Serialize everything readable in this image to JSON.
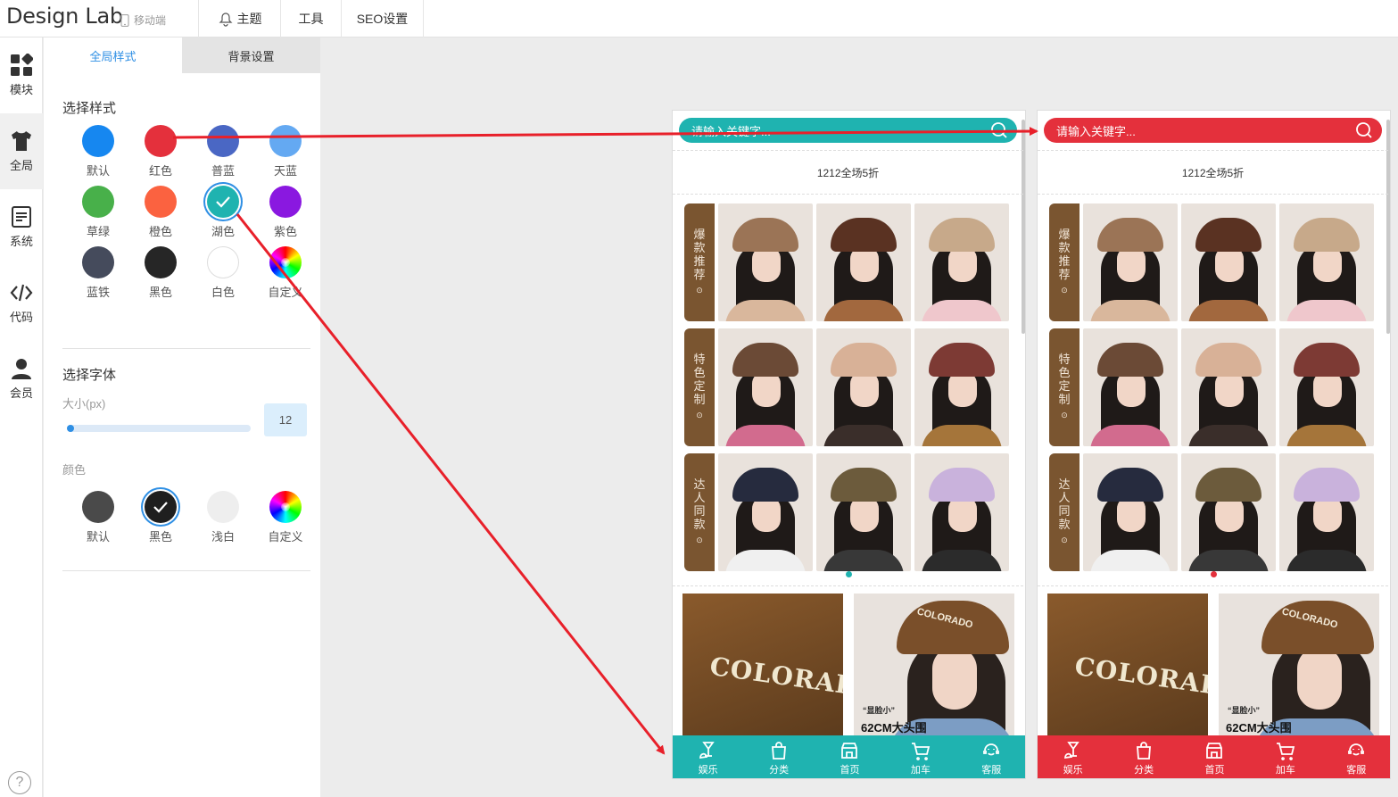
{
  "app": {
    "brand": "Design Lab",
    "mode": "移动端"
  },
  "topnav": {
    "theme": "主题",
    "tools": "工具",
    "seo": "SEO设置"
  },
  "rail": {
    "modules": "模块",
    "global": "全局",
    "system": "系统",
    "code": "代码",
    "member": "会员",
    "help": "?"
  },
  "panel": {
    "tab_global": "全局样式",
    "tab_background": "背景设置",
    "style_title": "选择样式",
    "styles": [
      {
        "label": "默认",
        "color": "#1687f0"
      },
      {
        "label": "红色",
        "color": "#e4303c"
      },
      {
        "label": "普蓝",
        "color": "#4a67c4"
      },
      {
        "label": "天蓝",
        "color": "#64a9f2"
      },
      {
        "label": "草绿",
        "color": "#48b04a"
      },
      {
        "label": "橙色",
        "color": "#fb6240"
      },
      {
        "label": "湖色",
        "color": "#1fb3b0",
        "selected": true
      },
      {
        "label": "紫色",
        "color": "#8a18e0"
      },
      {
        "label": "蓝铁",
        "color": "#454b5c"
      },
      {
        "label": "黑色",
        "color": "#262626"
      },
      {
        "label": "白色",
        "color": "#ffffff"
      },
      {
        "label": "自定义",
        "color": "rainbow"
      }
    ],
    "font_title": "选择字体",
    "size_label": "大小(px)",
    "size_value": "12",
    "color_label": "颜色",
    "font_colors": [
      {
        "label": "默认",
        "color": "#4a4a4a"
      },
      {
        "label": "黑色",
        "color": "#1f1f1f",
        "selected": true
      },
      {
        "label": "浅白",
        "color": "#eeeeee"
      },
      {
        "label": "自定义",
        "color": "rainbow"
      }
    ]
  },
  "preview": {
    "search_placeholder": "请输入关键字...",
    "promo": "1212全场5折",
    "row_labels": [
      "爆款推荐",
      "特色定制",
      "达人同款"
    ],
    "banner_brand": "COLORADO",
    "banner_cap_text": "COLORADO",
    "banner_quote": "“显脸小”",
    "banner_promo": "62CM大头围",
    "tabbar": [
      "娱乐",
      "分类",
      "首页",
      "加车",
      "客服"
    ],
    "theme_a": "#1fb3b0",
    "theme_b": "#e4303c"
  }
}
